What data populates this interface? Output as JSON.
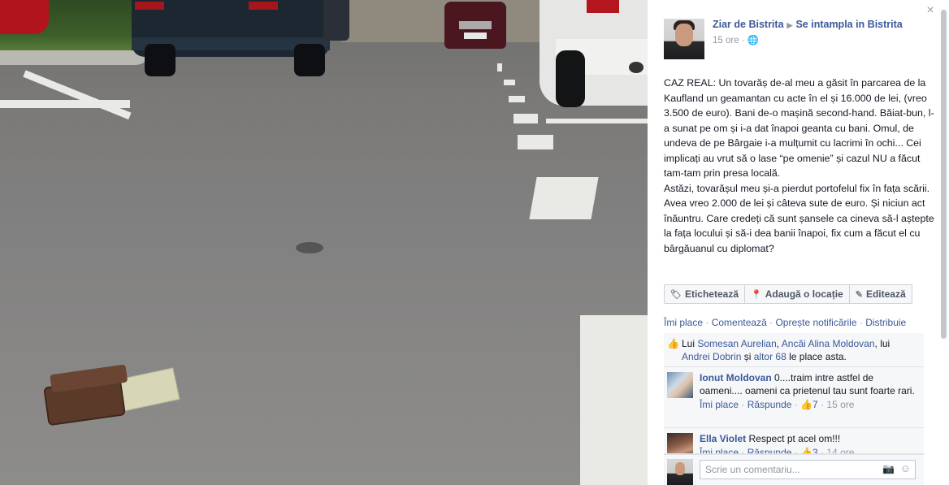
{
  "close_label": "×",
  "post": {
    "author": "Ziar de Bistrita",
    "group": "Se intampla in Bistrita",
    "time": "15 ore",
    "privacy_icon": "globe-icon",
    "text": "CAZ REAL: Un tovarăș de-al meu a găsit în parcarea de la Kaufland un geamantan cu acte în el și 16.000 de lei, (vreo 3.500 de euro). Bani de-o mașină second-hand. Băiat-bun, l-a sunat pe om și i-a dat înapoi geanta cu bani. Omul, de undeva de pe Bârgaie i-a mulțumit cu lacrimi în ochi... Cei implicați au vrut să o lase “pe omenie” și cazul NU a făcut tam-tam prin presa locală.\nAstăzi, tovarășul meu și-a pierdut portofelul fix în fața scării. Avea vreo 2.000 de lei și câteva sute de euro. Și niciun act înăuntru. Care credeți că sunt șansele ca cineva să-l aștepte la fața locului și să-i dea banii înapoi, fix cum a făcut el cu bârgăuanul cu diplomat?"
  },
  "tag_buttons": {
    "tag": "Etichetează",
    "location": "Adaugă o locație",
    "edit": "Editează"
  },
  "actions": {
    "like": "Îmi place",
    "comment": "Comentează",
    "stop_notifications": "Oprește notificările",
    "share": "Distribuie",
    "separator": "·"
  },
  "likes": {
    "prefix": "Lui",
    "names": [
      "Somesan Aurelian",
      "Ancăi Alina Moldovan",
      "Andrei Dobrin"
    ],
    "sep1": ",",
    "sep2": ", lui",
    "and": "și",
    "others": "altor 68",
    "suffix": "le place asta."
  },
  "comments": [
    {
      "author": "Ionut Moldovan",
      "text": "0....traim intre astfel de oameni.... oameni ca prietenul tau sunt foarte rari.",
      "like": "Îmi place",
      "reply": "Răspunde",
      "likes": "7",
      "time": "15 ore"
    },
    {
      "author": "Ella Violet",
      "text": "Respect pt acel om!!!",
      "like": "Îmi place",
      "reply": "Răspunde",
      "likes": "3",
      "time": "14 ore"
    }
  ],
  "composer": {
    "placeholder": "Scrie un comentariu..."
  },
  "colors": {
    "link": "#3b5998",
    "meta": "#9197a3",
    "like_blue": "#5890ff"
  }
}
